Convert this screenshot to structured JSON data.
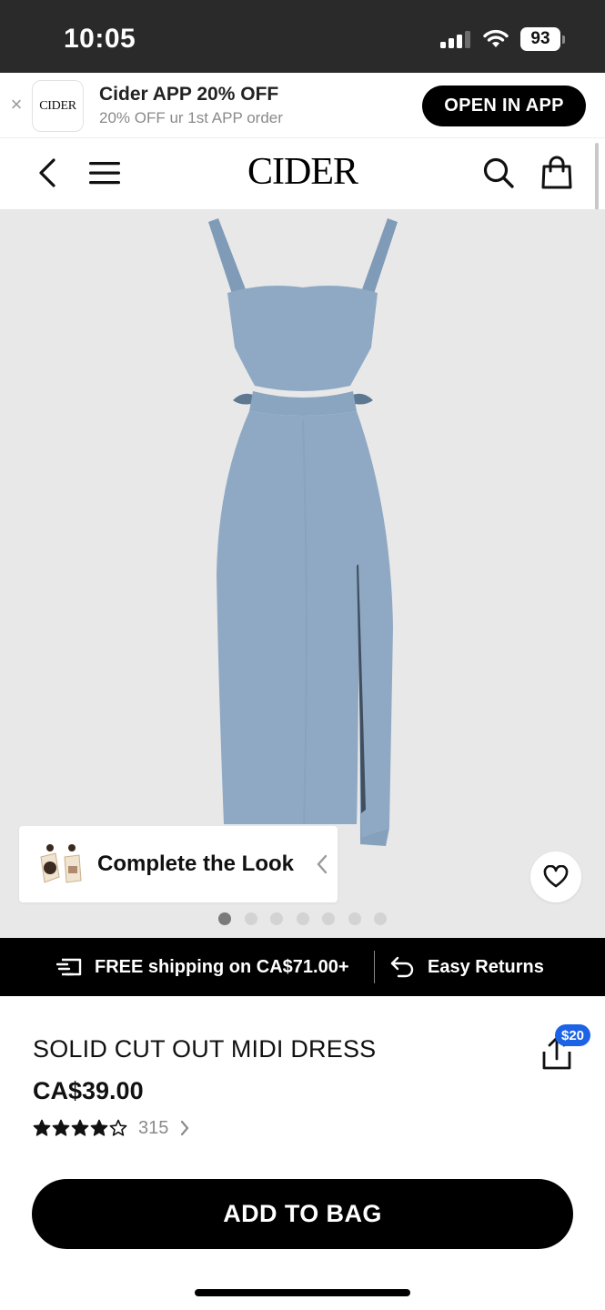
{
  "status_bar": {
    "time": "10:05",
    "battery": "93"
  },
  "app_banner": {
    "close_glyph": "×",
    "logo_text": "CIDER",
    "title": "Cider APP 20% OFF",
    "subtitle": "20% OFF ur 1st APP order",
    "open_button": "OPEN IN APP"
  },
  "nav": {
    "brand": "CIDER",
    "icons": [
      "back-icon",
      "menu-icon",
      "search-icon",
      "bag-icon"
    ]
  },
  "gallery": {
    "complete_look_label": "Complete the Look",
    "slide_count": 7,
    "active_slide": 1,
    "dress_color": "#8fa9c4",
    "background_color": "#e8e8e8"
  },
  "promo": {
    "shipping": "FREE shipping on CA$71.00+",
    "returns": "Easy Returns"
  },
  "product": {
    "title": "SOLID CUT OUT MIDI DRESS",
    "price": "CA$39.00",
    "rating": 4,
    "rating_max": 5,
    "review_count": "315",
    "share_badge": "$20"
  },
  "cta": {
    "add_to_bag": "ADD TO BAG"
  },
  "colors": {
    "accent": "#000000",
    "badge": "#1c63e6"
  }
}
